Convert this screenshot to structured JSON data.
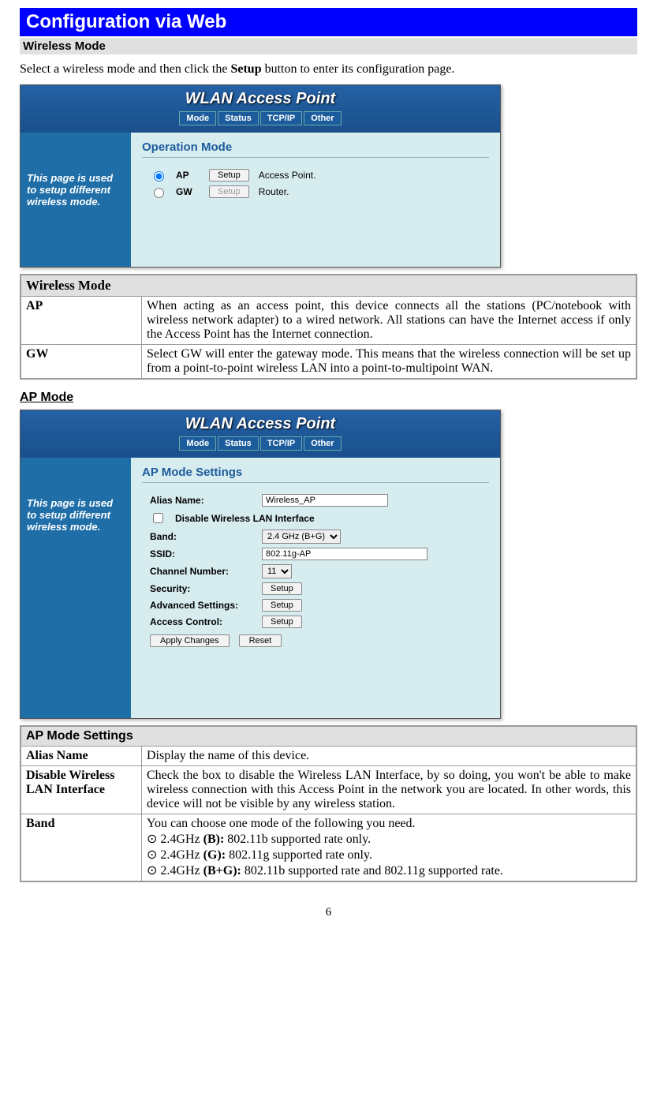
{
  "header": {
    "title": "Configuration via Web"
  },
  "section_wireless_mode": {
    "subheader": "Wireless Mode",
    "intro_before": "Select a wireless mode and then click the ",
    "intro_bold": "Setup",
    "intro_after": " button to enter its configuration page."
  },
  "shot_common": {
    "title": "WLAN Access Point",
    "tabs": [
      "Mode",
      "Status",
      "TCP/IP",
      "Other"
    ],
    "side_text": "This page is used to setup different wireless mode."
  },
  "shot1": {
    "panel_title": "Operation Mode",
    "ap_label": "AP",
    "gw_label": "GW",
    "setup_btn": "Setup",
    "ap_desc": "Access Point.",
    "gw_desc": "Router."
  },
  "table1": {
    "header": "Wireless Mode",
    "rows": [
      {
        "key": "AP",
        "val": "When acting as an access point, this device connects all the stations (PC/notebook with wireless network adapter) to a wired network. All stations can have the Internet access if only the Access Point has the Internet connection."
      },
      {
        "key": "GW",
        "val": "Select GW will enter the gateway mode. This means that the wireless connection will be set up from a point-to-point wireless LAN into a point-to-multipoint WAN."
      }
    ]
  },
  "section_ap_mode": {
    "heading": "AP Mode"
  },
  "shot2": {
    "panel_title": "AP Mode Settings",
    "alias_label": "Alias Name:",
    "alias_value": "Wireless_AP",
    "disable_label": "Disable Wireless LAN Interface",
    "band_label": "Band:",
    "band_value": "2.4 GHz (B+G)",
    "ssid_label": "SSID:",
    "ssid_value": "802.11g-AP",
    "channel_label": "Channel Number:",
    "channel_value": "11",
    "security_label": "Security:",
    "adv_label": "Advanced Settings:",
    "access_label": "Access Control:",
    "setup_btn": "Setup",
    "apply_btn": "Apply Changes",
    "reset_btn": "Reset"
  },
  "table2": {
    "header": "AP Mode Settings",
    "rows": [
      {
        "key": "Alias Name",
        "val": "Display the name of this device."
      },
      {
        "key": "Disable Wireless LAN Interface",
        "val": "Check the box to disable the Wireless LAN Interface, by so doing, you won't be able to make wireless connection with this Access Point in the network you are located. In other words, this device will not be visible by any wireless station."
      }
    ],
    "band_key": "Band",
    "band_intro": "You can choose one mode of the following you need.",
    "band_b_pre": " 2.4GHz ",
    "band_b_bold": "(B):",
    "band_b_post": " 802.11b supported rate only.",
    "band_g_pre": "2.4GHz ",
    "band_g_bold": "(G):",
    "band_g_post": " 802.11g supported rate only.",
    "band_bg_pre": "2.4GHz ",
    "band_bg_bold": "(B+G):",
    "band_bg_post": " 802.11b supported rate and 802.11g supported rate."
  },
  "page_number": "6"
}
